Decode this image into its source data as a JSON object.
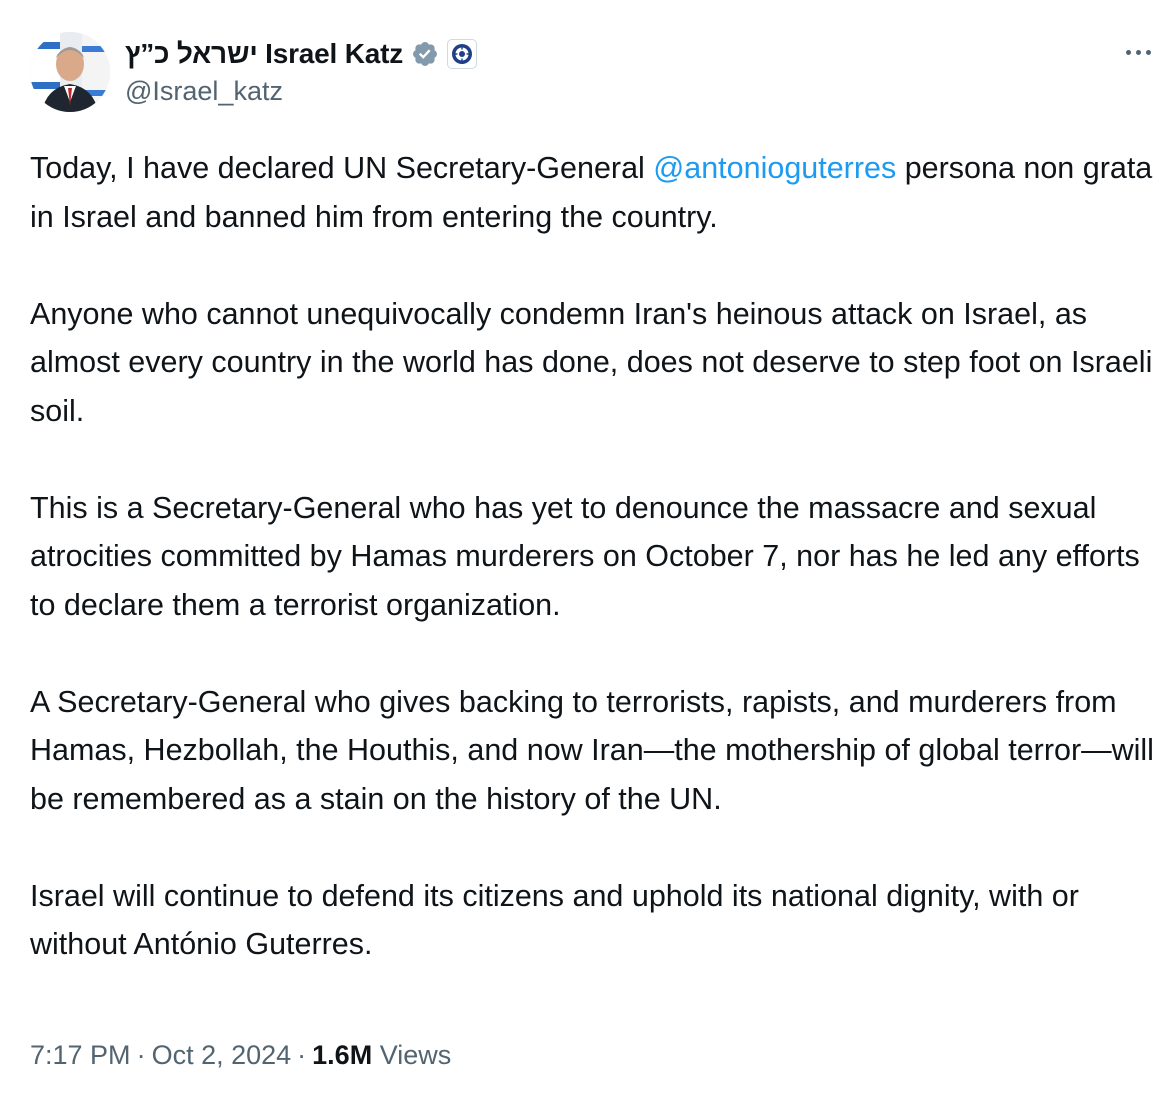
{
  "author": {
    "display_name": "ישראל כ”ץ Israel Katz",
    "handle": "@Israel_katz",
    "verified_icon": "verified-badge-icon",
    "affiliate_icon": "government-affiliation-icon"
  },
  "tweet": {
    "paragraphs": [
      {
        "before": "Today, I have declared UN Secretary-General ",
        "mention": "@antonioguterres",
        "after": " persona non grata in Israel and banned him from entering the country."
      },
      {
        "text": "Anyone who cannot unequivocally condemn Iran's heinous attack on Israel, as almost every country in the world has done, does not deserve to step foot on Israeli soil."
      },
      {
        "text": "This is a Secretary-General who has yet to denounce the massacre and sexual atrocities committed by Hamas murderers on October 7, nor has he led any efforts to declare them a terrorist organization."
      },
      {
        "text": "A Secretary-General who gives backing to terrorists, rapists, and murderers from Hamas, Hezbollah, the Houthis, and now Iran—the mothership of global terror—will be remembered as a stain on the history of the UN."
      },
      {
        "text": "Israel will continue to defend its citizens and uphold its national dignity, with or without António Guterres."
      }
    ]
  },
  "meta": {
    "time": "7:17 PM",
    "separator": "·",
    "date": "Oct 2, 2024",
    "views_count": "1.6M",
    "views_label": "Views"
  },
  "colors": {
    "text": "#0f1419",
    "secondary": "#536471",
    "link": "#1d9bf0",
    "verified": "#829aab"
  }
}
